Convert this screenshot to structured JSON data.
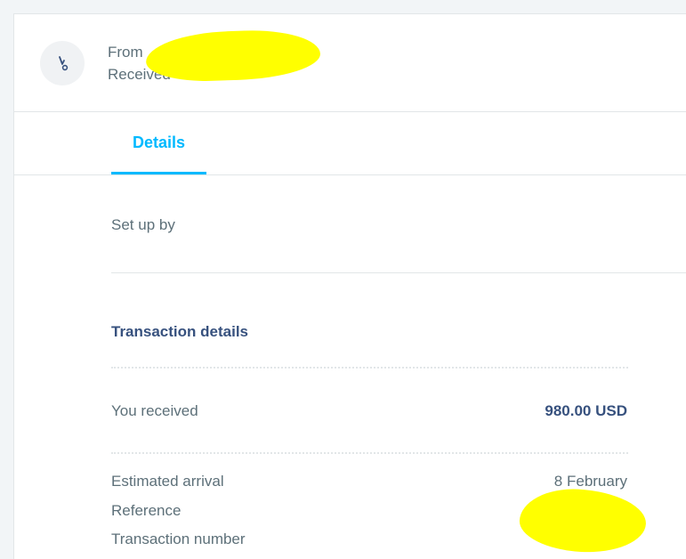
{
  "header": {
    "from_label": "From",
    "status": "Received",
    "icon": "received-arrow-icon"
  },
  "tabs": [
    {
      "label": "Details",
      "active": true
    }
  ],
  "setup": {
    "label": "Set up by"
  },
  "transaction": {
    "title": "Transaction details",
    "received_label": "You received",
    "received_value": "980.00 USD",
    "arrival_label": "Estimated arrival",
    "arrival_value": "8 February",
    "reference_label": "Reference",
    "number_label": "Transaction number"
  },
  "colors": {
    "accent": "#00b9ff",
    "heading": "#37517e",
    "text": "#5d7079",
    "redaction": "#ffff00"
  }
}
